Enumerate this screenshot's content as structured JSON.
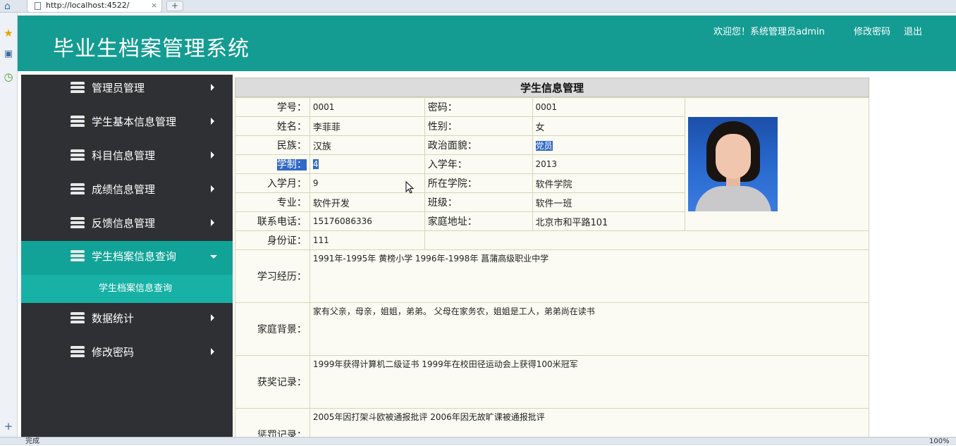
{
  "browser": {
    "url": "http://localhost:4522/",
    "tab_close": "×",
    "new_tab": "+",
    "status": "完成",
    "zoom": "100%"
  },
  "header": {
    "title": "毕业生档案管理系统",
    "welcome": "欢迎您！系统管理员admin",
    "change_password": "修改密码",
    "logout": "退出",
    "color": "#149c93"
  },
  "sidebar": {
    "items": [
      {
        "label": "管理员管理"
      },
      {
        "label": "学生基本信息管理"
      },
      {
        "label": "科目信息管理"
      },
      {
        "label": "成绩信息管理"
      },
      {
        "label": "反馈信息管理"
      },
      {
        "label": "学生档案信息查询"
      },
      {
        "label": "数据统计"
      },
      {
        "label": "修改密码"
      }
    ],
    "sub_item": "学生档案信息查询",
    "active_color": "#11a397"
  },
  "panel": {
    "title": "学生信息管理",
    "fields": {
      "student_id_label": "学号：",
      "student_id": "0001",
      "password_label": "密码：",
      "password": "0001",
      "name_label": "姓名：",
      "name": "李菲菲",
      "gender_label": "性别：",
      "gender": "女",
      "ethnicity_label": "民族：",
      "ethnicity": "汉族",
      "political_label": "政治面貌：",
      "political": "党员",
      "duration_label": "学制：",
      "duration": "4",
      "enroll_year_label": "入学年：",
      "enroll_year": "2013",
      "enroll_month_label": "入学月：",
      "enroll_month": "9",
      "college_label": "所在学院：",
      "college": "软件学院",
      "major_label": "专业：",
      "major": "软件开发",
      "class_label": "班级：",
      "class": "软件一班",
      "phone_label": "联系电话：",
      "phone": "15176086336",
      "address_label": "家庭地址：",
      "address": "北京市和平路101",
      "id_card_label": "身份证：",
      "id_card": "111",
      "education_label": "学习经历：",
      "education": "1991年-1995年 黄榜小学 1996年-1998年 菖蒲高级职业中学",
      "family_label": "家庭背景：",
      "family": "家有父亲，母亲，姐姐，弟弟。 父母在家务农，姐姐是工人，弟弟尚在读书",
      "awards_label": "获奖记录：",
      "awards": "1999年获得计算机二级证书 1999年在校田径运动会上获得100米冠军",
      "punishment_label": "惩罚记录：",
      "punishment": "2005年因打架斗欧被通报批评 2006年因无故旷课被通报批评"
    }
  }
}
